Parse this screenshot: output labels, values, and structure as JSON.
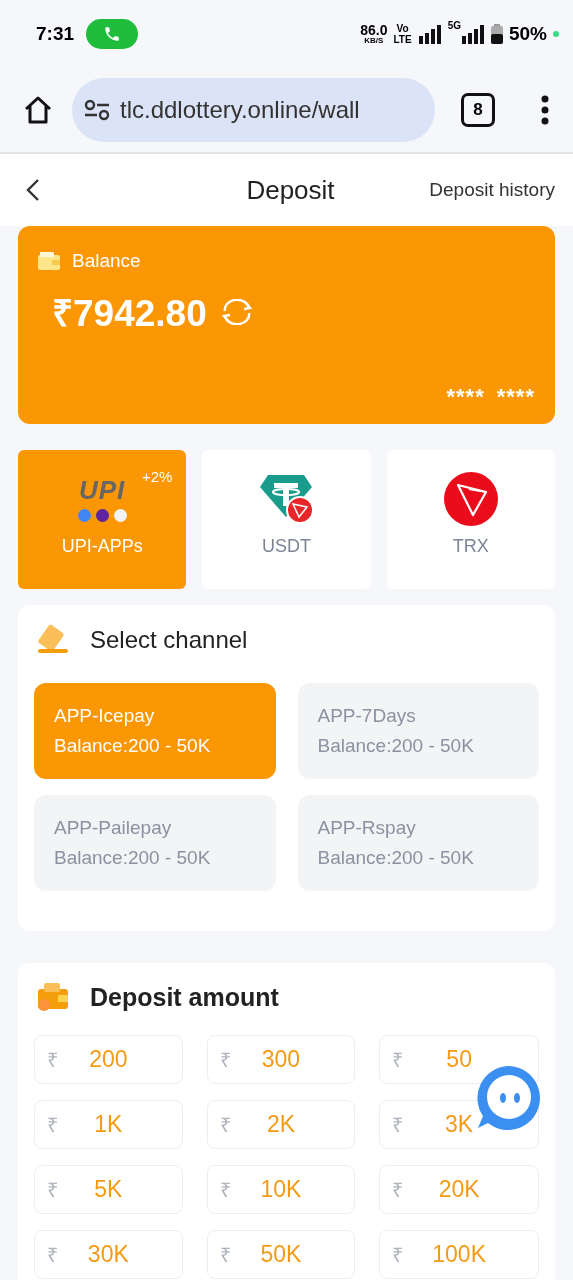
{
  "status_bar": {
    "time": "7:31",
    "speed": "86.0",
    "speed_unit": "KB/S",
    "volte_top": "Vo",
    "volte_bottom": "LTE",
    "network": "5G",
    "battery": "50%"
  },
  "browser": {
    "url": "tlc.ddlottery.online/wall",
    "tab_count": "8"
  },
  "header": {
    "title": "Deposit",
    "history_link": "Deposit history"
  },
  "balance": {
    "label": "Balance",
    "amount": "₹7942.80",
    "card_mask": [
      "****",
      "****"
    ]
  },
  "methods": [
    {
      "kind": "upi",
      "logo": "UPI",
      "bonus": "+2%",
      "label": "UPI-APPs",
      "selected": true
    },
    {
      "kind": "usdt",
      "label": "USDT",
      "selected": false
    },
    {
      "kind": "trx",
      "label": "TRX",
      "selected": false
    }
  ],
  "channels": {
    "title": "Select channel",
    "items": [
      {
        "name": "APP-Icepay",
        "range": "Balance:200 - 50K",
        "selected": true
      },
      {
        "name": "APP-7Days",
        "range": "Balance:200 - 50K",
        "selected": false
      },
      {
        "name": "APP-Pailepay",
        "range": "Balance:200 - 50K",
        "selected": false
      },
      {
        "name": "APP-Rspay",
        "range": "Balance:200 - 50K",
        "selected": false
      }
    ]
  },
  "amounts": {
    "title": "Deposit amount",
    "items": [
      {
        "symbol": "₹",
        "value": "200"
      },
      {
        "symbol": "₹",
        "value": "300"
      },
      {
        "symbol": "₹",
        "value": "50"
      },
      {
        "symbol": "₹",
        "value": "1K"
      },
      {
        "symbol": "₹",
        "value": "2K"
      },
      {
        "symbol": "₹",
        "value": "3K"
      },
      {
        "symbol": "₹",
        "value": "5K"
      },
      {
        "symbol": "₹",
        "value": "10K"
      },
      {
        "symbol": "₹",
        "value": "20K"
      },
      {
        "symbol": "₹",
        "value": "30K"
      },
      {
        "symbol": "₹",
        "value": "50K"
      },
      {
        "symbol": "₹",
        "value": "100K"
      }
    ]
  }
}
